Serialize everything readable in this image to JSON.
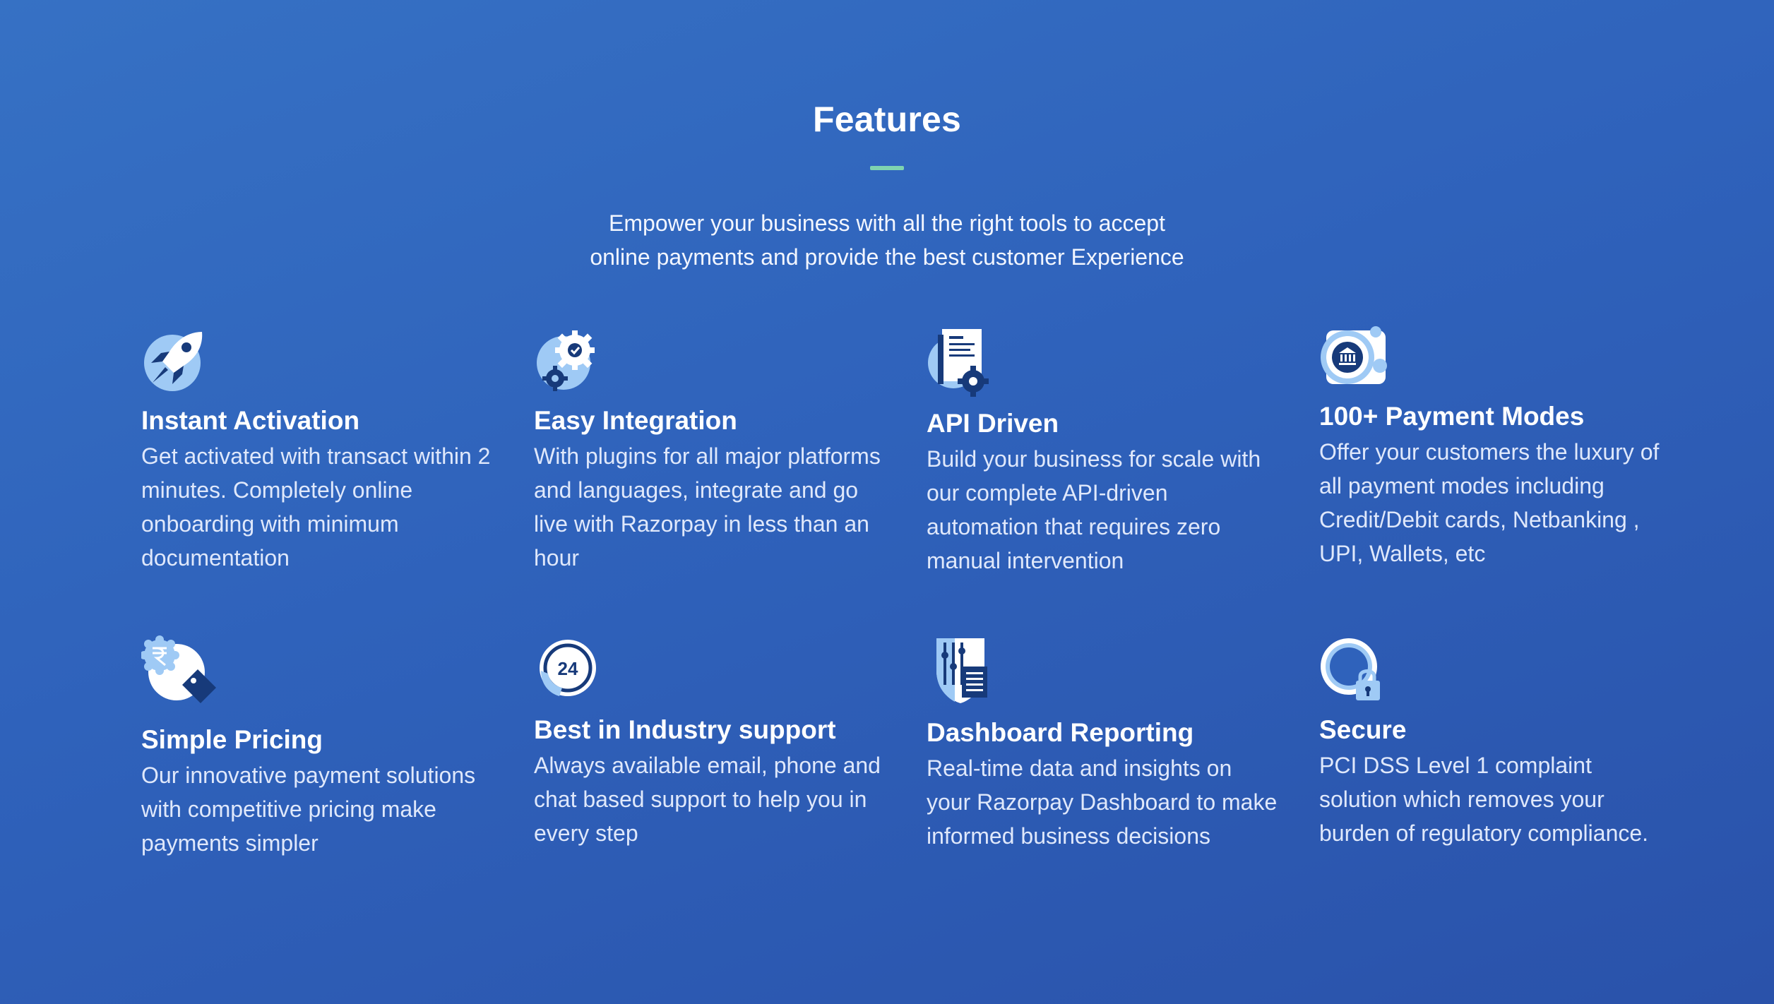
{
  "section": {
    "title": "Features",
    "subtitle_lines": [
      "Empower your business with all the right tools to accept",
      "online payments and provide the best customer Experience"
    ]
  },
  "features": [
    {
      "title": "Instant Activation",
      "icon": "rocket-icon",
      "desc": "Get activated with transact within 2 minutes. Completely online onboarding with minimum documentation"
    },
    {
      "title": "Easy Integration",
      "icon": "gears-icon",
      "desc": "With plugins for all major platforms and languages, integrate and go live with Razorpay in less than an hour"
    },
    {
      "title": "API Driven",
      "icon": "document-gear-icon",
      "desc": "Build your business for scale with our complete API-driven automation that requires zero manual intervention"
    },
    {
      "title": "100+ Payment Modes",
      "icon": "bank-payment-icon",
      "desc": "Offer your customers the luxury of all payment modes including Credit/Debit cards, Netbanking , UPI, Wallets, etc"
    },
    {
      "title": "Simple Pricing",
      "icon": "rupee-price-tag-icon",
      "desc": "Our innovative payment solutions with competitive pricing make payments simpler"
    },
    {
      "title": "Best in Industry support",
      "icon": "support-24-icon",
      "icon_text": "24",
      "desc": "Always available email, phone and chat based support to help you in every step"
    },
    {
      "title": "Dashboard Reporting",
      "icon": "dashboard-report-icon",
      "desc": "Real-time data and insights on your Razorpay Dashboard to make informed business decisions"
    },
    {
      "title": "Secure",
      "icon": "padlock-icon",
      "desc": "PCI DSS Level 1 complaint solution which removes your burden of regulatory compliance."
    }
  ],
  "colors": {
    "background_start": "#3671c4",
    "background_end": "#2a52aa",
    "accent_rule": "#7fd3b0",
    "icon_light": "#9fcaf5",
    "icon_dark": "#173a7a"
  }
}
